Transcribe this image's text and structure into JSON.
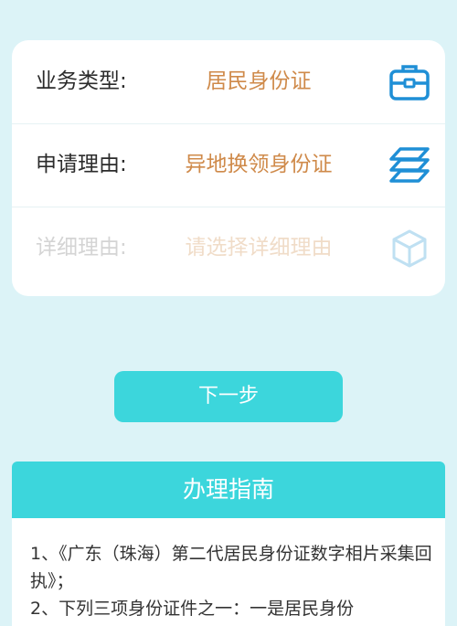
{
  "form": {
    "business_type": {
      "label": "业务类型:",
      "value": "居民身份证",
      "icon": "briefcase-icon"
    },
    "apply_reason": {
      "label": "申请理由:",
      "value": "异地换领身份证",
      "icon": "layers-icon"
    },
    "detail_reason": {
      "label": "详细理由:",
      "placeholder": "请选择详细理由",
      "icon": "cube-icon"
    }
  },
  "next_button": {
    "label": "下一步"
  },
  "guide": {
    "title": "办理指南",
    "items": [
      "1、《广东（珠海）第二代居民身份证数字相片采集回执》；",
      "2、下列三项身份证件之一：一是居民身份"
    ]
  },
  "colors": {
    "background": "#dcf3f7",
    "accent": "#3cd6dc",
    "value_text": "#cf8a4a",
    "icon_blue": "#1f8fd6"
  }
}
